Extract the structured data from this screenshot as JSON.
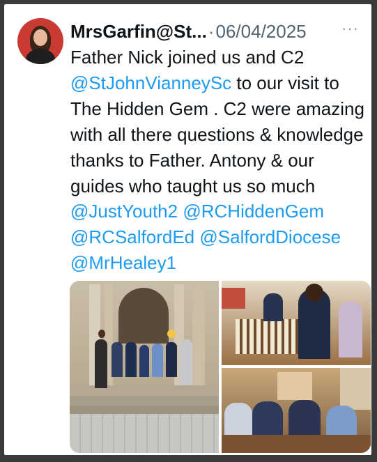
{
  "tweet": {
    "display_name": "MrsGarfin@St...",
    "separator": "·",
    "date": "06/04/2025",
    "more_glyph": "···",
    "text": {
      "p1": "Father Nick joined us and C2 ",
      "mention_school": "@StJohnVianneySc",
      "p2": "  to our visit to The Hidden Gem . C2 were amazing with all there questions & knowledge thanks to Father. Antony & our guides who taught us so much ",
      "mention_1": "@JustYouth2",
      "mention_2": "@RCHiddenGem",
      "mention_3": "@RCSalfordEd",
      "mention_4": "@SalfordDiocese",
      "mention_5": "@MrHealey1"
    }
  },
  "media": {
    "photos": [
      "group-on-church-steps-photo",
      "lighting-candles-photo",
      "pupils-in-pews-photo"
    ]
  }
}
